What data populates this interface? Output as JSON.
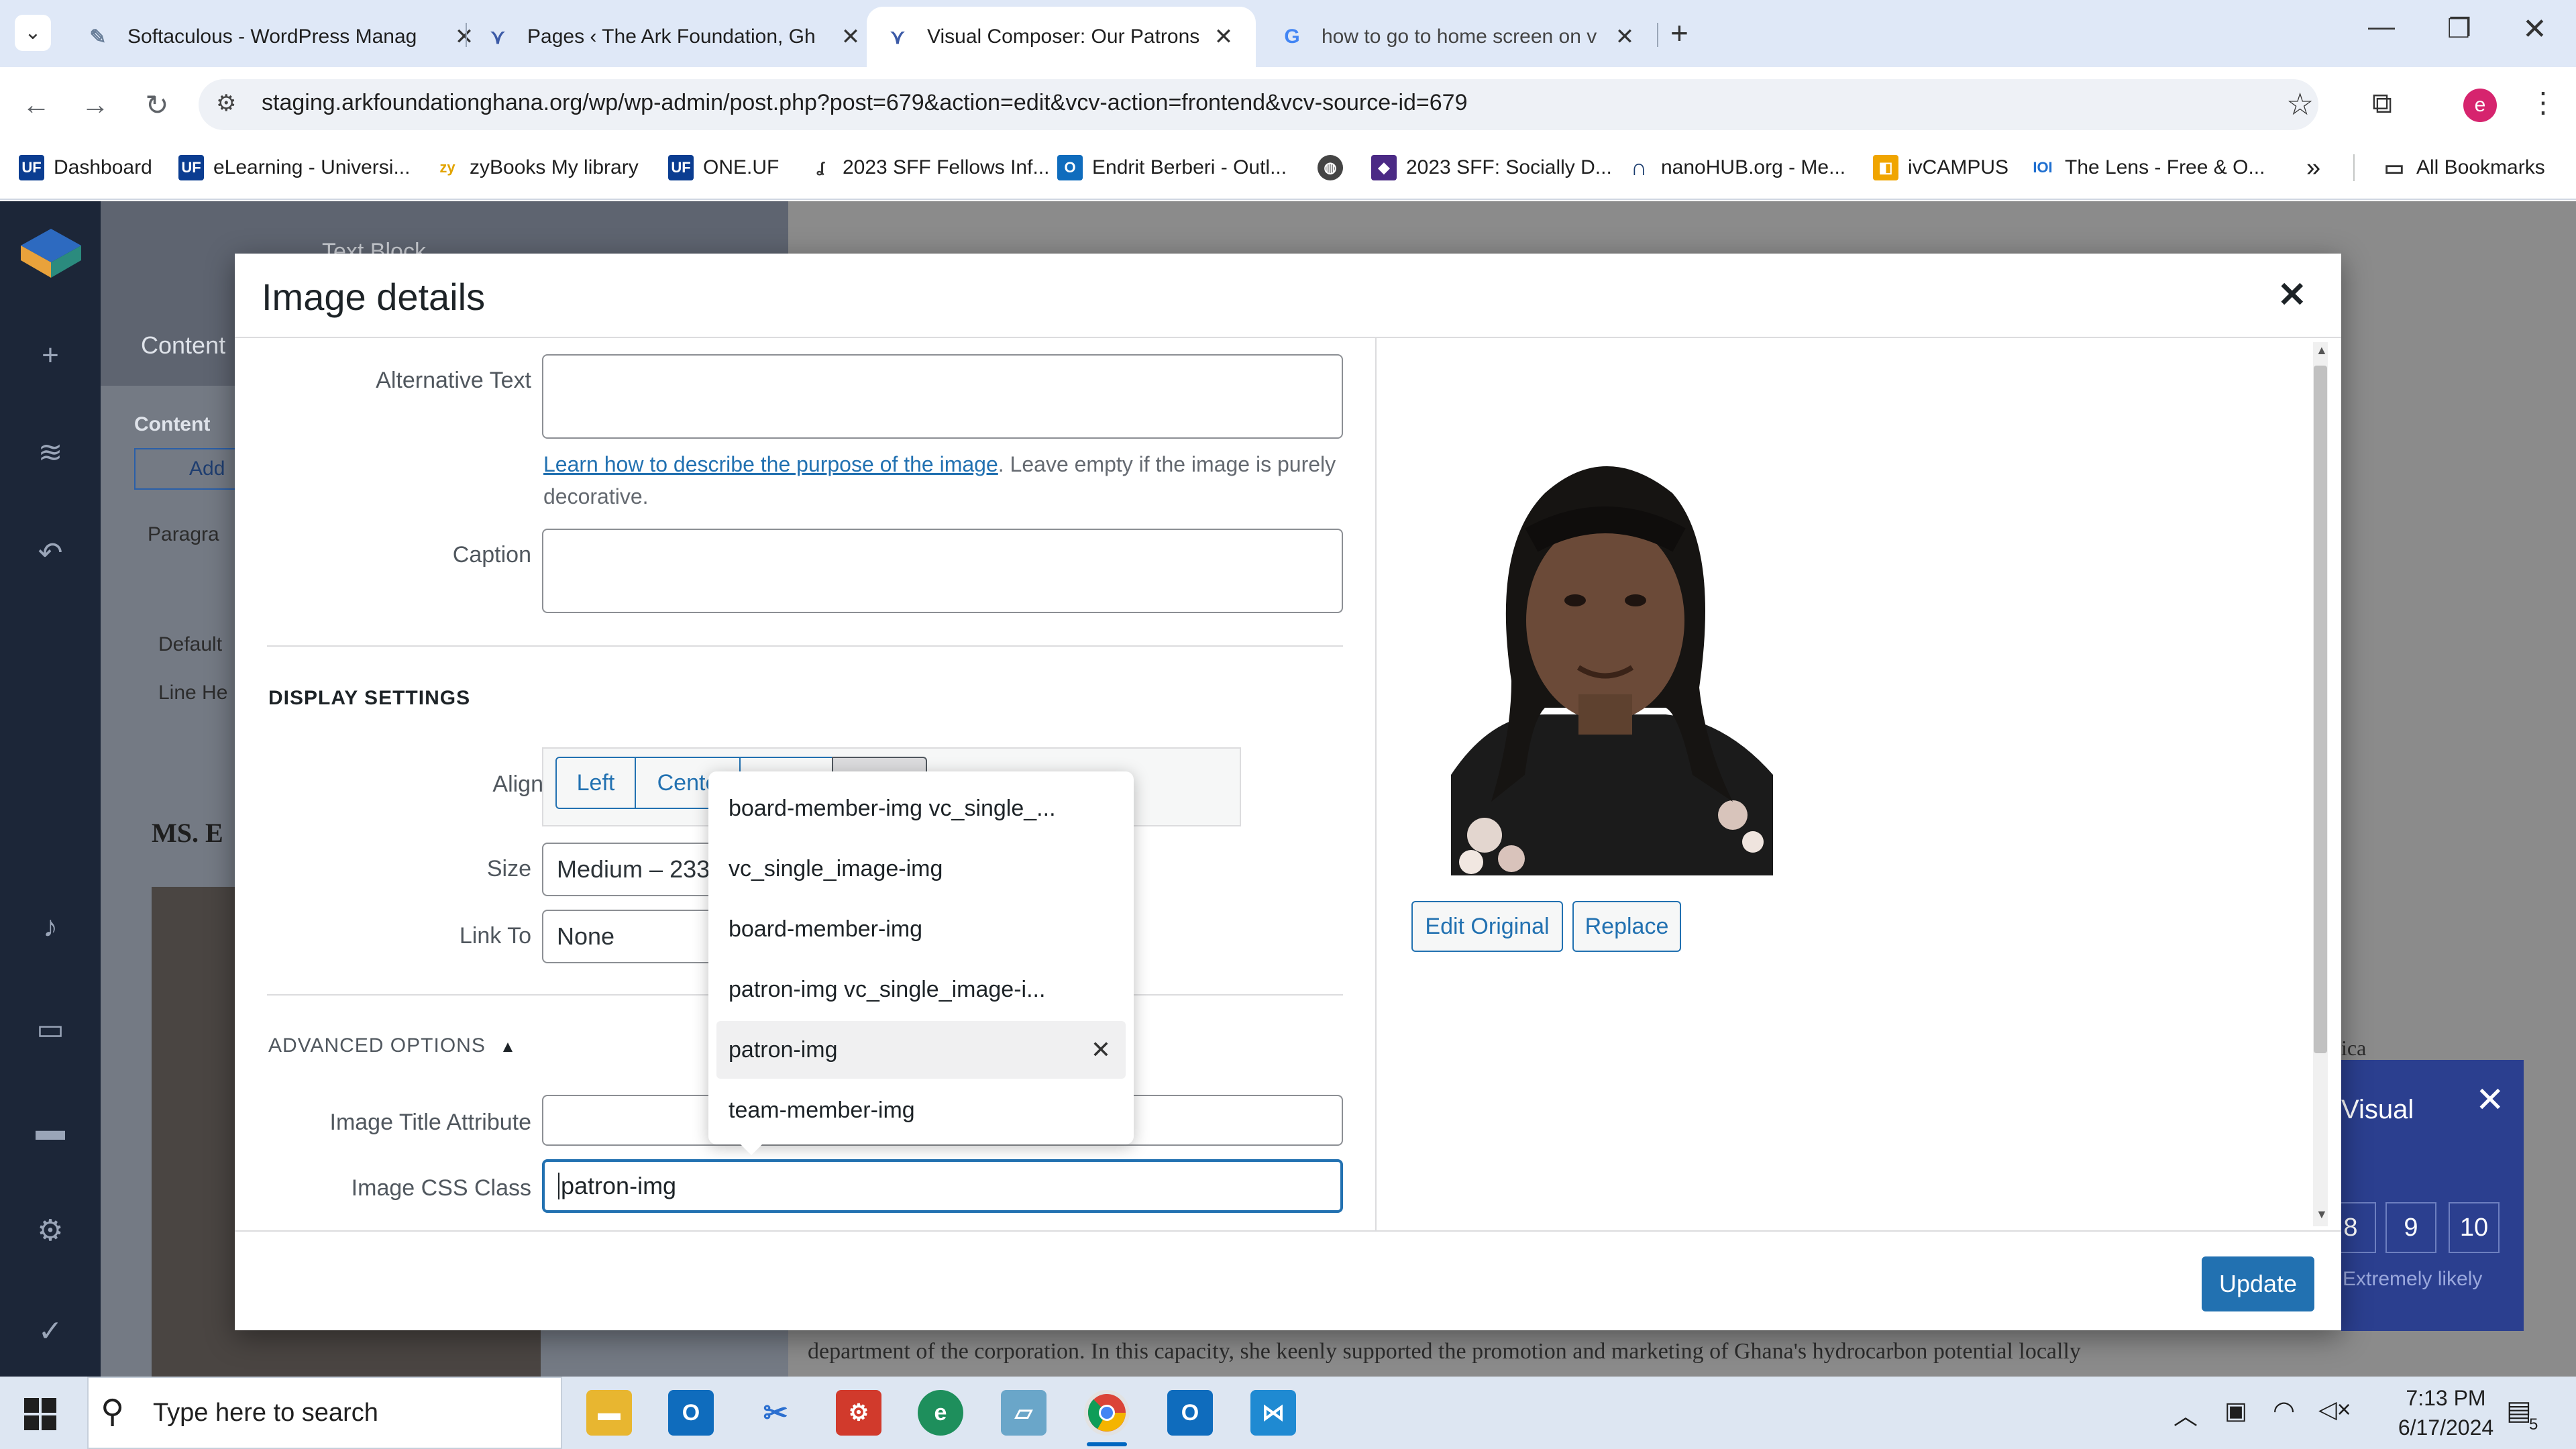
{
  "browser": {
    "tabs": [
      {
        "title": "Softaculous - WordPress Manag",
        "icon": "softaculous-icon",
        "active": false
      },
      {
        "title": "Pages ‹ The Ark Foundation, Gh",
        "icon": "visual-composer-icon",
        "active": false
      },
      {
        "title": "Visual Composer: Our Patrons",
        "icon": "visual-composer-icon",
        "active": true
      },
      {
        "title": "how to go to home screen on v",
        "icon": "google-icon",
        "active": false
      }
    ],
    "url": "staging.arkfoundationghana.org/wp/wp-admin/post.php?post=679&action=edit&vcv-action=frontend&vcv-source-id=679",
    "profile_initial": "e",
    "bookmarks": [
      {
        "label": "Dashboard",
        "icon": "uf-icon"
      },
      {
        "label": "eLearning - Universi...",
        "icon": "uf-icon"
      },
      {
        "label": "zyBooks My library",
        "icon": "zybooks-icon"
      },
      {
        "label": "ONE.UF",
        "icon": "uf-icon"
      },
      {
        "label": "2023 SFF Fellows Inf...",
        "icon": "document-icon"
      },
      {
        "label": "Endrit Berberi - Outl...",
        "icon": "outlook-icon"
      },
      {
        "label": "",
        "icon": "globe-icon"
      },
      {
        "label": "2023 SFF: Socially D...",
        "icon": "cube-icon"
      },
      {
        "label": "nanoHUB.org - Me...",
        "icon": "nanohub-icon"
      },
      {
        "label": "ivCAMPUS",
        "icon": "ivcampus-icon"
      },
      {
        "label": "The Lens - Free & O...",
        "icon": "lens-icon"
      }
    ],
    "all_bookmarks_label": "All Bookmarks"
  },
  "modal": {
    "title": "Image details",
    "fields": {
      "alt_text_label": "Alternative Text",
      "alt_text_value": "",
      "alt_help_link": "Learn how to describe the purpose of the image",
      "alt_help_rest": ". Leave empty if the image is purely decorative.",
      "caption_label": "Caption",
      "caption_value": ""
    },
    "display_settings": {
      "heading": "DISPLAY SETTINGS",
      "align_label": "Align",
      "align_options": [
        "Left",
        "Cente",
        "",
        ""
      ],
      "size_label": "Size",
      "size_value": "Medium – 233",
      "link_label": "Link To",
      "link_value": "None"
    },
    "advanced": {
      "heading": "ADVANCED OPTIONS",
      "toggle_glyph": "▲",
      "title_attr_label": "Image Title Attribute",
      "title_attr_value": "",
      "css_class_label": "Image CSS Class",
      "css_class_value": "patron-img"
    },
    "suggestions": [
      {
        "label": "board-member-img vc_single_...",
        "selected": false
      },
      {
        "label": "vc_single_image-img",
        "selected": false
      },
      {
        "label": "board-member-img",
        "selected": false
      },
      {
        "label": "patron-img vc_single_image-i...",
        "selected": false
      },
      {
        "label": "patron-img",
        "selected": true
      },
      {
        "label": "team-member-img",
        "selected": false
      }
    ],
    "preview": {
      "edit_original_label": "Edit Original",
      "replace_label": "Replace"
    },
    "update_label": "Update"
  },
  "background": {
    "panel_tab": "Content",
    "panel_section": "Content",
    "panel_add": "Add",
    "panel_title": "Text Block",
    "paragraph_select": "Paragra",
    "default_select": "Default",
    "line_height": "Line He",
    "name_heading": "MS. E",
    "survey_title": "Visual",
    "survey_scale": [
      "8",
      "9",
      "10"
    ],
    "survey_hint": "Extremely likely",
    "site_text": "department of the corporation. In this capacity, she keenly supported the promotion and marketing of Ghana's hydrocarbon potential locally",
    "side_text": "ica"
  },
  "taskbar": {
    "search_placeholder": "Type here to search",
    "time": "7:13 PM",
    "date": "6/17/2024",
    "notification_count": "5"
  },
  "colors": {
    "wp_blue": "#2271b1",
    "chrome_tabstrip": "#dfe8f7",
    "vc_sidebar": "#1c2638",
    "profile": "#d6246e"
  }
}
